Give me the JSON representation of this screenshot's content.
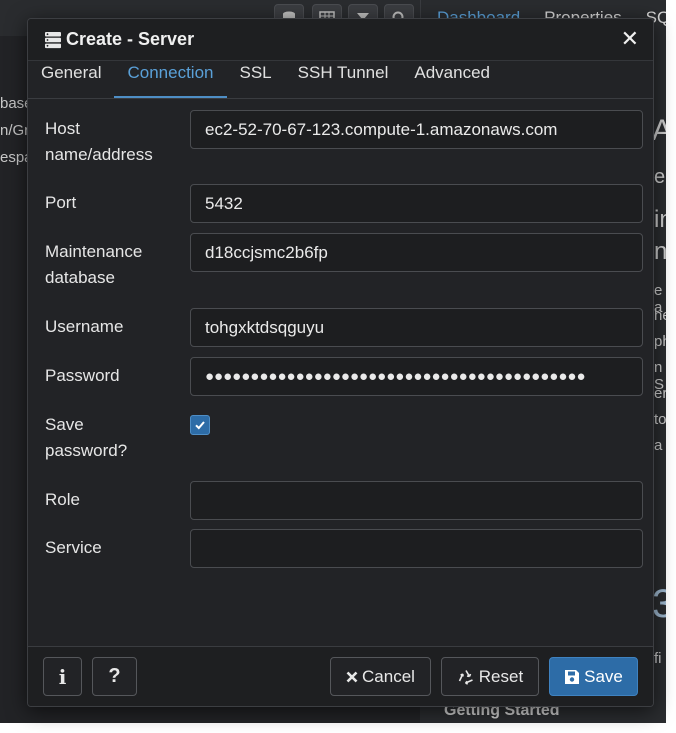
{
  "background": {
    "tabs": [
      "Dashboard",
      "Properties",
      "SQ"
    ],
    "left_fragments": [
      "base",
      "n/Gr",
      "espa"
    ],
    "right_fragments": [
      "er",
      "in",
      "n",
      "e a",
      "he",
      "ph",
      "n S",
      "er",
      "to",
      "a"
    ],
    "getting_started": "Getting Started",
    "bottom_right_fragment": "fi"
  },
  "dialog": {
    "title": "Create - Server",
    "title_icon": "server-icon",
    "close_icon": "close-icon",
    "tabs": [
      {
        "label": "General",
        "active": false
      },
      {
        "label": "Connection",
        "active": true
      },
      {
        "label": "SSL",
        "active": false
      },
      {
        "label": "SSH Tunnel",
        "active": false
      },
      {
        "label": "Advanced",
        "active": false
      }
    ],
    "fields": {
      "host": {
        "label_line1": "Host",
        "label_line2": "name/address",
        "value": "ec2-52-70-67-123.compute-1.amazonaws.com"
      },
      "port": {
        "label": "Port",
        "value": "5432"
      },
      "maintenance_db": {
        "label_line1": "Maintenance",
        "label_line2": "database",
        "value": "d18ccjsmc2b6fp"
      },
      "username": {
        "label": "Username",
        "value": "tohgxktdsqguyu"
      },
      "password": {
        "label": "Password",
        "value": "●●●●●●●●●●●●●●●●●●●●●●●●●●●●●●●●●●●●●●●●●●"
      },
      "save_password": {
        "label_line1": "Save",
        "label_line2": "password?",
        "checked": true
      },
      "role": {
        "label": "Role",
        "value": ""
      },
      "service": {
        "label": "Service",
        "value": ""
      }
    },
    "footer": {
      "info_icon": "info-icon",
      "help_label": "?",
      "cancel_label": "Cancel",
      "reset_label": "Reset",
      "save_label": "Save"
    }
  },
  "colors": {
    "accent": "#5aa0d8",
    "primary_button": "#2d6ca7",
    "dialog_bg": "#222326",
    "input_bg": "#1d1e20"
  }
}
